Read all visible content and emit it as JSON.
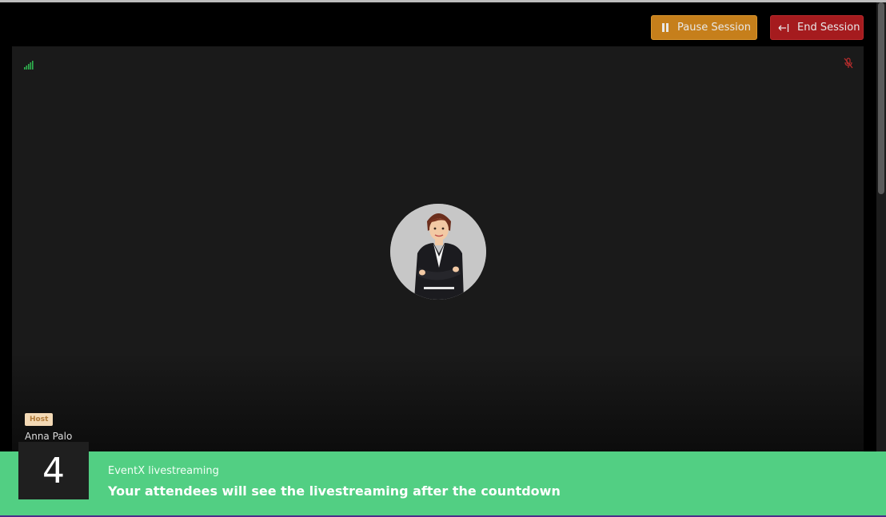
{
  "toolbar": {
    "pause_label": "Pause Session",
    "end_label": "End Session"
  },
  "tile": {
    "role_badge": "Host",
    "participant_name": "Anna Palo",
    "signal_color": "#2fb24f",
    "mic_muted_color": "#b92d2d"
  },
  "banner": {
    "countdown": "4",
    "title": "EventX livestreaming",
    "subtitle": "Your attendees will see the livestreaming after the countdown"
  },
  "colors": {
    "pause": "#c67f1b",
    "end": "#a51b1e",
    "banner": "#52cf83"
  },
  "icons": {
    "pause": "pause-icon",
    "end": "exit-arrow-icon",
    "signal": "signal-strength-icon",
    "mic": "mic-muted-icon"
  }
}
